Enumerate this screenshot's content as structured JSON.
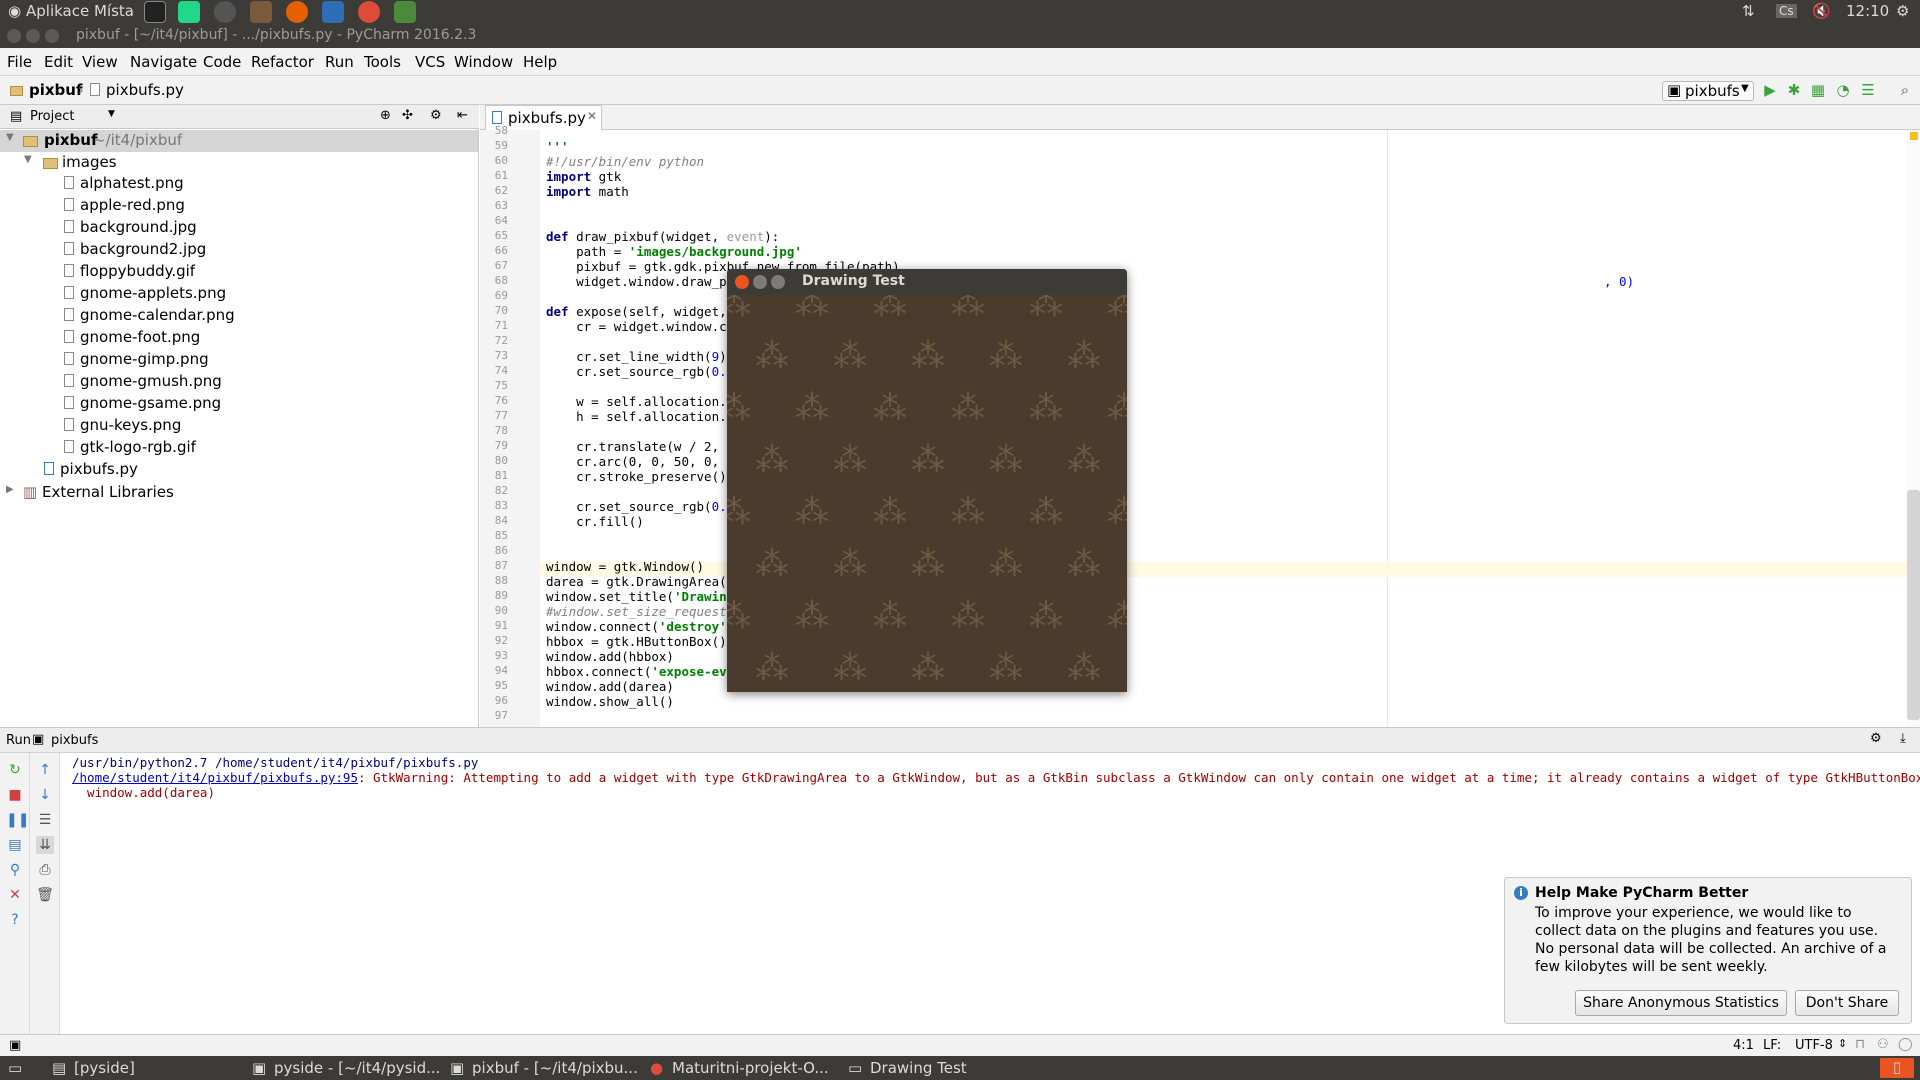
{
  "topbar": {
    "apps_label": "Aplikace",
    "places_label": "Místa",
    "lang": "Cs",
    "clock": "12:10"
  },
  "window": {
    "title": "pixbuf - [~/it4/pixbuf] - .../pixbufs.py - PyCharm 2016.2.3"
  },
  "menu": [
    "File",
    "Edit",
    "View",
    "Navigate",
    "Code",
    "Refactor",
    "Run",
    "Tools",
    "VCS",
    "Window",
    "Help"
  ],
  "breadcrumb": {
    "project": "pixbuf",
    "file": "pixbufs.py"
  },
  "run_config": "pixbufs",
  "project_panel": {
    "title": "Project",
    "root_name": "pixbuf",
    "root_path": "~/it4/pixbuf",
    "folder": "images",
    "files": [
      "alphatest.png",
      "apple-red.png",
      "background.jpg",
      "background2.jpg",
      "floppybuddy.gif",
      "gnome-applets.png",
      "gnome-calendar.png",
      "gnome-foot.png",
      "gnome-gimp.png",
      "gnome-gmush.png",
      "gnome-gsame.png",
      "gnu-keys.png",
      "gtk-logo-rgb.gif"
    ],
    "main_file": "pixbufs.py",
    "external": "External Libraries"
  },
  "editor": {
    "tab": "pixbufs.py",
    "line_numbers": [
      "58",
      "59",
      "60",
      "61",
      "62",
      "63",
      "64",
      "65",
      "66",
      "67",
      "68",
      "69",
      "70",
      "71",
      "72",
      "73",
      "74",
      "75",
      "76",
      "77",
      "78",
      "79",
      "80",
      "81",
      "82",
      "83",
      "84",
      "85",
      "86",
      "87",
      "88",
      "89",
      "90",
      "91",
      "92",
      "93",
      "94",
      "95",
      "96",
      "97"
    ],
    "lines": {
      "l59": "'''",
      "l60": "#!/usr/bin/env python",
      "l61a": "import",
      "l61b": " gtk",
      "l62a": "import",
      "l62b": " math",
      "l65a": "def",
      "l65b": " draw_pixbuf(widget, ",
      "l65c": "event",
      "l65d": "):",
      "l66a": "    path = ",
      "l66b": "'images/background.jpg'",
      "l67": "    pixbuf = gtk.gdk.pixbuf_new_from_file(path)",
      "l68": "    widget.window.draw_pix",
      "l68tail": ", 0)",
      "l70a": "def",
      "l70b": " expose(self, widget, e",
      "l71": "    cr = widget.window.cai",
      "l73a": "    cr.set_line_width(",
      "l73b": "9",
      "l73c": ")",
      "l74a": "    cr.set_source_rgb(",
      "l74b": "0.7,",
      "l76": "    w = self.allocation.wi",
      "l77": "    h = self.allocation.he",
      "l79": "    cr.translate(w / 2, h",
      "l80": "    cr.arc(0, 0, 50, 0, 2",
      "l81": "    cr.stroke_preserve()",
      "l83a": "    cr.set_source_rgb(",
      "l83b": "0.3,",
      "l84": "    cr.fill()",
      "l87": "window = gtk.Window()",
      "l88": "darea = gtk.DrawingArea()",
      "l89a": "window.set_title(",
      "l89b": "'Drawing",
      "l90": "#window.set_size_request(6",
      "l91a": "window.connect(",
      "l91b": "'destroy'",
      "l91c": ",",
      "l92": "hbbox = gtk.HButtonBox()",
      "l93": "window.add(hbbox)",
      "l94a": "hbbox.connect(",
      "l94b": "'expose-even",
      "l95": "window.add(darea)",
      "l96": "window.show_all()"
    }
  },
  "dialog": {
    "title": "Drawing Test"
  },
  "run_panel": {
    "label": "Run",
    "config": "pixbufs",
    "cmd": "/usr/bin/python2.7 /home/student/it4/pixbuf/pixbufs.py",
    "link": "/home/student/it4/pixbuf/pixbufs.py:95",
    "warning": ": GtkWarning: Attempting to add a widget with type GtkDrawingArea to a GtkWindow, but as a GtkBin subclass a GtkWindow can only contain one widget at a time; it already contains a widget of type GtkHButtonBox",
    "warning2": "  window.add(darea)"
  },
  "notification": {
    "title": "Help Make PyCharm Better",
    "line1": "To improve your experience, we would like to",
    "line2": "collect data on the plugins and features you use.",
    "line3": "No personal data will be collected. An archive of a",
    "line4": "few kilobytes will be sent weekly.",
    "share": "Share Anonymous Statistics",
    "dont": "Don't Share"
  },
  "status": {
    "position": "4:1",
    "lf": "LF:",
    "encoding": "UTF-8"
  },
  "taskbar": [
    "[pyside]",
    "pyside - [~/it4/pysid...",
    "pixbuf - [~/it4/pixbu...",
    "Maturitni-projekt-O...",
    "Drawing Test"
  ],
  "colors": {
    "accent": "#3c3b37",
    "code_keyword": "#000080",
    "code_string": "#008000",
    "error": "#a00000"
  }
}
